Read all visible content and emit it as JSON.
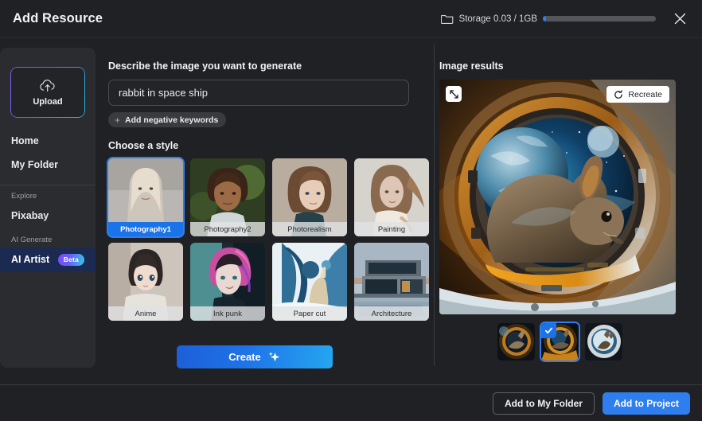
{
  "header": {
    "title": "Add Resource",
    "storage_text": "Storage 0.03 / 1GB",
    "storage_percent": 3,
    "folder_icon": "folder-icon",
    "close_icon": "close-icon"
  },
  "sidebar": {
    "upload": {
      "label": "Upload",
      "icon": "cloud-upload-icon"
    },
    "items": [
      {
        "label": "Home",
        "active": false
      },
      {
        "label": "My Folder",
        "active": false
      }
    ],
    "sections": [
      {
        "title": "Explore",
        "items": [
          {
            "label": "Pixabay",
            "active": false,
            "badge": ""
          }
        ]
      },
      {
        "title": "AI Generate",
        "items": [
          {
            "label": "AI Artist",
            "active": true,
            "badge": "Beta"
          }
        ]
      }
    ]
  },
  "form": {
    "prompt_label": "Describe the image you want to generate",
    "prompt_value": "rabbit in space ship",
    "prompt_placeholder": "Describe the image you want to generate",
    "negative_keywords_label": "Add negative keywords",
    "style_label": "Choose a style",
    "styles": [
      {
        "name": "Photography1",
        "selected": true
      },
      {
        "name": "Photography2",
        "selected": false
      },
      {
        "name": "Photorealism",
        "selected": false
      },
      {
        "name": "Painting",
        "selected": false
      },
      {
        "name": "Anime",
        "selected": false
      },
      {
        "name": "Ink punk",
        "selected": false
      },
      {
        "name": "Paper cut",
        "selected": false
      },
      {
        "name": "Architecture",
        "selected": false
      }
    ],
    "create_label": "Create",
    "create_icon": "sparkle-icon"
  },
  "results": {
    "title": "Image results",
    "expand_icon": "expand-diagonal-icon",
    "recreate_label": "Recreate",
    "recreate_icon": "refresh-icon",
    "thumbnails": [
      {
        "selected": false
      },
      {
        "selected": true
      },
      {
        "selected": false
      }
    ]
  },
  "footer": {
    "add_to_folder_label": "Add to My Folder",
    "add_to_project_label": "Add to Project"
  },
  "colors": {
    "accent_blue": "#2f7ef0",
    "selected_label_blue": "#1a73e8",
    "panel": "#2b2c2f",
    "background": "#202124"
  }
}
